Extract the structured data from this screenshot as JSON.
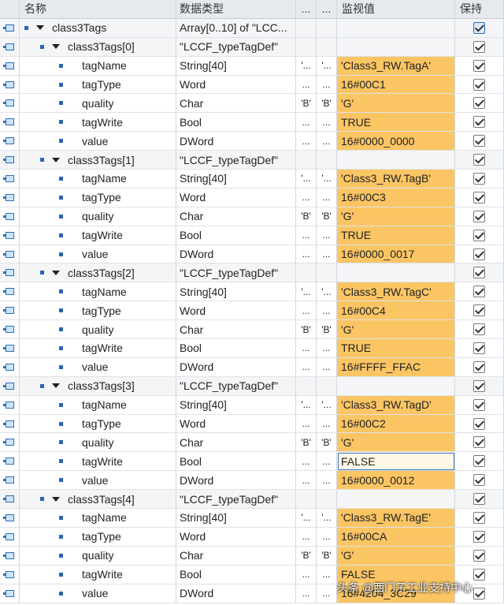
{
  "header": {
    "name": "名称",
    "datatype": "数据类型",
    "start": "...",
    "start2": "...",
    "monitor": "监视值",
    "retain": "保持"
  },
  "root": {
    "name": "class3Tags",
    "type": "Array[0..10] of \"LCC..."
  },
  "groups": [
    {
      "name": "class3Tags[0]",
      "type": "\"LCCF_typeTagDef\"",
      "fields": [
        {
          "name": "tagName",
          "type": "String[40]",
          "s1": "'...",
          "s2": "'...",
          "mon": "'Class3_RW.TagA'"
        },
        {
          "name": "tagType",
          "type": "Word",
          "s1": "...",
          "s2": "...",
          "mon": "16#00C1"
        },
        {
          "name": "quality",
          "type": "Char",
          "s1": "'B'",
          "s2": "'B'",
          "mon": "'G'"
        },
        {
          "name": "tagWrite",
          "type": "Bool",
          "s1": "...",
          "s2": "...",
          "mon": "TRUE"
        },
        {
          "name": "value",
          "type": "DWord",
          "s1": "...",
          "s2": "...",
          "mon": "16#0000_0000"
        }
      ]
    },
    {
      "name": "class3Tags[1]",
      "type": "\"LCCF_typeTagDef\"",
      "fields": [
        {
          "name": "tagName",
          "type": "String[40]",
          "s1": "'...",
          "s2": "'...",
          "mon": "'Class3_RW.TagB'"
        },
        {
          "name": "tagType",
          "type": "Word",
          "s1": "...",
          "s2": "...",
          "mon": "16#00C3"
        },
        {
          "name": "quality",
          "type": "Char",
          "s1": "'B'",
          "s2": "'B'",
          "mon": "'G'"
        },
        {
          "name": "tagWrite",
          "type": "Bool",
          "s1": "...",
          "s2": "...",
          "mon": "TRUE"
        },
        {
          "name": "value",
          "type": "DWord",
          "s1": "...",
          "s2": "...",
          "mon": "16#0000_0017"
        }
      ]
    },
    {
      "name": "class3Tags[2]",
      "type": "\"LCCF_typeTagDef\"",
      "fields": [
        {
          "name": "tagName",
          "type": "String[40]",
          "s1": "'...",
          "s2": "'...",
          "mon": "'Class3_RW.TagC'"
        },
        {
          "name": "tagType",
          "type": "Word",
          "s1": "...",
          "s2": "...",
          "mon": "16#00C4"
        },
        {
          "name": "quality",
          "type": "Char",
          "s1": "'B'",
          "s2": "'B'",
          "mon": "'G'"
        },
        {
          "name": "tagWrite",
          "type": "Bool",
          "s1": "...",
          "s2": "...",
          "mon": "TRUE"
        },
        {
          "name": "value",
          "type": "DWord",
          "s1": "...",
          "s2": "...",
          "mon": "16#FFFF_FFAC"
        }
      ]
    },
    {
      "name": "class3Tags[3]",
      "type": "\"LCCF_typeTagDef\"",
      "fields": [
        {
          "name": "tagName",
          "type": "String[40]",
          "s1": "'...",
          "s2": "'...",
          "mon": "'Class3_RW.TagD'"
        },
        {
          "name": "tagType",
          "type": "Word",
          "s1": "...",
          "s2": "...",
          "mon": "16#00C2"
        },
        {
          "name": "quality",
          "type": "Char",
          "s1": "'B'",
          "s2": "'B'",
          "mon": "'G'"
        },
        {
          "name": "tagWrite",
          "type": "Bool",
          "s1": "...",
          "s2": "...",
          "mon": "FALSE",
          "selected": true
        },
        {
          "name": "value",
          "type": "DWord",
          "s1": "...",
          "s2": "...",
          "mon": "16#0000_0012"
        }
      ]
    },
    {
      "name": "class3Tags[4]",
      "type": "\"LCCF_typeTagDef\"",
      "fields": [
        {
          "name": "tagName",
          "type": "String[40]",
          "s1": "'...",
          "s2": "'...",
          "mon": "'Class3_RW.TagE'"
        },
        {
          "name": "tagType",
          "type": "Word",
          "s1": "...",
          "s2": "...",
          "mon": "16#00CA"
        },
        {
          "name": "quality",
          "type": "Char",
          "s1": "'B'",
          "s2": "'B'",
          "mon": "'G'"
        },
        {
          "name": "tagWrite",
          "type": "Bool",
          "s1": "...",
          "s2": "...",
          "mon": "FALSE"
        },
        {
          "name": "value",
          "type": "DWord",
          "s1": "...",
          "s2": "...",
          "mon": "16#4204_3C29"
        }
      ]
    }
  ],
  "watermark": "头条 @西门子工业支持中心",
  "colors": {
    "monitor_highlight": "#fbc564",
    "header_bg": "#e6e9ed",
    "icon_blue": "#2b6fb6"
  }
}
